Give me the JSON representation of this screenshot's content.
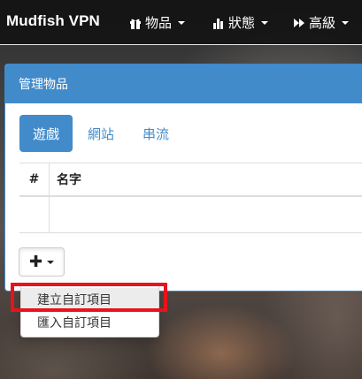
{
  "navbar": {
    "brand": "Mudfish VPN",
    "items": [
      {
        "icon": "gift-icon",
        "label": "物品"
      },
      {
        "icon": "bar-chart-icon",
        "label": "狀態"
      },
      {
        "icon": "fast-forward-icon",
        "label": "高級"
      }
    ]
  },
  "panel": {
    "title": "管理物品",
    "tabs": [
      {
        "label": "遊戲",
        "active": true
      },
      {
        "label": "網站",
        "active": false
      },
      {
        "label": "串流",
        "active": false
      }
    ],
    "table": {
      "columns": [
        "#",
        "名字"
      ],
      "rows": []
    },
    "add_button": {
      "icon": "plus-icon"
    }
  },
  "dropdown_menu": {
    "items": [
      {
        "label": "建立自訂項目",
        "highlighted": true
      },
      {
        "label": "匯入自訂項目",
        "highlighted": false
      }
    ]
  },
  "colors": {
    "primary": "#428bca",
    "navbar_bg": "#141414",
    "highlight_outline": "#e8131b"
  }
}
